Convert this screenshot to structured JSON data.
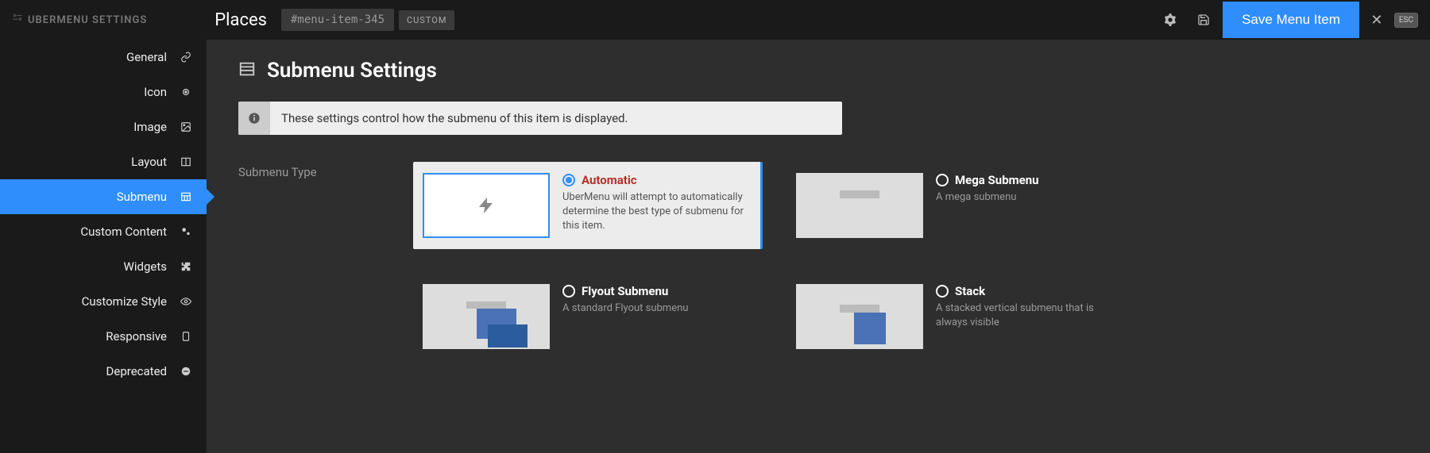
{
  "header": {
    "brand": "UBERMENU SETTINGS",
    "title": "Places",
    "menu_id": "#menu-item-345",
    "custom_label": "CUSTOM",
    "save_label": "Save Menu Item",
    "esc_label": "ESC"
  },
  "sidebar": {
    "items": [
      {
        "label": "General",
        "icon": "link"
      },
      {
        "label": "Icon",
        "icon": "target"
      },
      {
        "label": "Image",
        "icon": "image"
      },
      {
        "label": "Layout",
        "icon": "columns"
      },
      {
        "label": "Submenu",
        "icon": "grid",
        "active": true
      },
      {
        "label": "Custom Content",
        "icon": "cogs"
      },
      {
        "label": "Widgets",
        "icon": "puzzle"
      },
      {
        "label": "Customize Style",
        "icon": "eye"
      },
      {
        "label": "Responsive",
        "icon": "tablet"
      },
      {
        "label": "Deprecated",
        "icon": "minus-circle"
      }
    ]
  },
  "main": {
    "page_title": "Submenu Settings",
    "info": "These settings control how the submenu of this item is displayed.",
    "field_label": "Submenu Type",
    "options": [
      {
        "key": "auto",
        "title": "Automatic",
        "desc": "UberMenu will attempt to automatically determine the best type of submenu for this item.",
        "selected": true
      },
      {
        "key": "mega",
        "title": "Mega Submenu",
        "desc": "A mega submenu"
      },
      {
        "key": "flyout",
        "title": "Flyout Submenu",
        "desc": "A standard Flyout submenu"
      },
      {
        "key": "stack",
        "title": "Stack",
        "desc": "A stacked vertical submenu that is always visible"
      }
    ]
  }
}
